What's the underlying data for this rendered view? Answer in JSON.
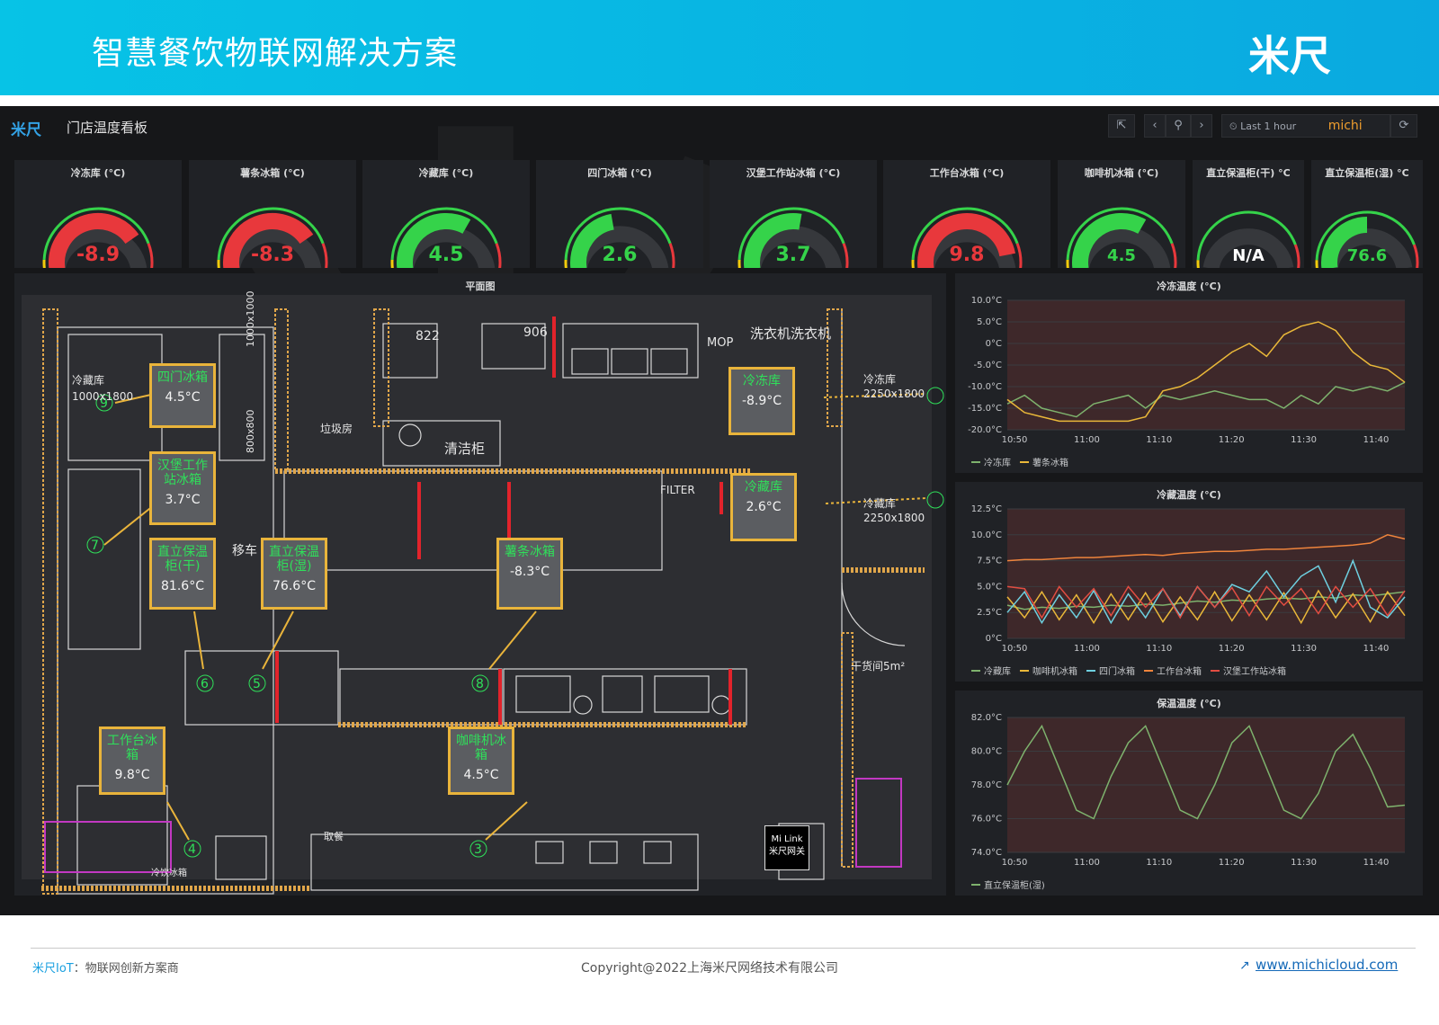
{
  "banner": {
    "title": "智慧餐饮物联网解决方案",
    "logo": "米尺"
  },
  "dashboard": {
    "logo": "米尺",
    "title": "门店温度看板",
    "toolbar": {
      "time_range": "Last 1 hour",
      "user": "michi"
    },
    "gauges": [
      {
        "title": "冷冻库 (°C)",
        "value": "-8.9",
        "level": 0.78,
        "color": "#e8383c"
      },
      {
        "title": "薯条冰箱 (°C)",
        "value": "-8.3",
        "level": 0.78,
        "color": "#e8383c"
      },
      {
        "title": "冷藏库 (°C)",
        "value": "4.5",
        "level": 0.65,
        "color": "#35d34a"
      },
      {
        "title": "四门冰箱 (°C)",
        "value": "2.6",
        "level": 0.45,
        "color": "#35d34a"
      },
      {
        "title": "汉堡工作站冰箱 (°C)",
        "value": "3.7",
        "level": 0.55,
        "color": "#35d34a"
      },
      {
        "title": "工作台冰箱 (°C)",
        "value": "9.8",
        "level": 0.9,
        "color": "#e8383c"
      },
      {
        "title": "咖啡机冰箱 (°C)",
        "value": "4.5",
        "level": 0.65,
        "color": "#35d34a"
      },
      {
        "title": "直立保温柜(干) °C",
        "value": "N/A",
        "level": 0,
        "color": "#ffffff"
      },
      {
        "title": "直立保温柜(湿) °C",
        "value": "76.6",
        "level": 0.5,
        "color": "#35d34a"
      }
    ],
    "floorplan": {
      "title": "平面图",
      "labels": [
        {
          "name": "四门冰箱",
          "temp": "4.5°C"
        },
        {
          "name": "汉堡工作站冰箱",
          "temp": "3.7°C"
        },
        {
          "name": "直立保温柜(干)",
          "temp": "81.6°C"
        },
        {
          "name": "直立保温柜(湿)",
          "temp": "76.6°C"
        },
        {
          "name": "薯条冰箱",
          "temp": "-8.3°C"
        },
        {
          "name": "冷冻库",
          "temp": "-8.9°C"
        },
        {
          "name": "冷藏库",
          "temp": "2.6°C"
        },
        {
          "name": "工作台冰箱",
          "temp": "9.8°C"
        },
        {
          "name": "咖啡机冰箱",
          "temp": "4.5°C"
        }
      ],
      "room_texts": {
        "cold_room": "冷藏库",
        "cold_room_size": "1000x1800",
        "freezer_right": "冷冻库",
        "freezer_right_size": "2250x1800",
        "cold_right": "冷藏库",
        "cold_right_size": "2250x1800",
        "garbage": "垃圾房",
        "cleaning": "清洁柜",
        "mop": "MOP",
        "washer": "洗衣机洗衣机",
        "dry_store": "干货间5m²",
        "filter": "FILTER",
        "gateway_line1": "Mi Link",
        "gateway_line2": "米尺网关",
        "take_meal": "取餐",
        "cold_drink": "冷饮冰箱",
        "num_822": "822",
        "num_906": "906",
        "dim1": "1000x1000",
        "dim2": "800x800",
        "cart": "移车"
      }
    },
    "charts": [
      {
        "title": "冷冻温度 (°C)",
        "chart_data": {
          "type": "line",
          "x": [
            "10:50",
            "11:00",
            "11:10",
            "11:20",
            "11:30",
            "11:40"
          ],
          "y_ticks": [
            "10.0°C",
            "5.0°C",
            "0°C",
            "-5.0°C",
            "-10.0°C",
            "-15.0°C",
            "-20.0°C"
          ],
          "ylim": [
            -20,
            10
          ],
          "series": [
            {
              "name": "冷冻库",
              "color": "#7eb26d",
              "values": [
                -14,
                -12,
                -15,
                -16,
                -17,
                -14,
                -13,
                -12,
                -15,
                -12,
                -13,
                -12,
                -11,
                -12,
                -13,
                -13,
                -15,
                -12,
                -14,
                -10,
                -11,
                -10,
                -11,
                -9
              ]
            },
            {
              "name": "薯条冰箱",
              "color": "#eab839",
              "values": [
                -13,
                -16,
                -17,
                -18,
                -18,
                -18,
                -18,
                -18,
                -17,
                -11,
                -10,
                -8,
                -5,
                -2,
                0,
                -3,
                2,
                4,
                5,
                3,
                -2,
                -5,
                -6,
                -9
              ]
            }
          ]
        }
      },
      {
        "title": "冷藏温度 (°C)",
        "chart_data": {
          "type": "line",
          "x": [
            "10:50",
            "11:00",
            "11:10",
            "11:20",
            "11:30",
            "11:40"
          ],
          "y_ticks": [
            "12.5°C",
            "10.0°C",
            "7.5°C",
            "5.0°C",
            "2.5°C",
            "0°C"
          ],
          "ylim": [
            0,
            12.5
          ],
          "series": [
            {
              "name": "冷藏库",
              "color": "#7eb26d",
              "values": [
                3.2,
                2.8,
                3.0,
                2.9,
                3.1,
                3.0,
                3.2,
                3.1,
                3.3,
                3.2,
                3.4,
                3.6,
                3.5,
                3.7,
                3.6,
                3.8,
                3.9,
                3.8,
                4.0,
                3.9,
                4.2,
                4.1,
                4.3,
                4.5
              ]
            },
            {
              "name": "咖啡机冰箱",
              "color": "#eab839",
              "values": [
                4.0,
                2.0,
                4.5,
                1.8,
                4.2,
                1.5,
                4.3,
                1.8,
                4.4,
                1.6,
                4.0,
                1.8,
                4.5,
                1.7,
                4.2,
                1.8,
                4.4,
                1.5,
                4.6,
                2.0,
                4.3,
                1.6,
                4.5,
                2.2
              ]
            },
            {
              "name": "四门冰箱",
              "color": "#6ed0e0",
              "values": [
                2.5,
                4.5,
                1.5,
                4.2,
                2.0,
                4.6,
                1.5,
                4.3,
                2.0,
                4.8,
                2.2,
                5.0,
                3.0,
                5.2,
                4.5,
                6.5,
                4.0,
                6.0,
                7.0,
                3.5,
                7.5,
                3.0,
                2.0,
                4.0
              ]
            },
            {
              "name": "工作台冰箱",
              "color": "#ef843c",
              "values": [
                7.5,
                7.6,
                7.6,
                7.7,
                7.8,
                7.8,
                7.9,
                8.0,
                8.1,
                8.0,
                8.2,
                8.3,
                8.4,
                8.4,
                8.5,
                8.6,
                8.6,
                8.7,
                8.8,
                8.9,
                9.0,
                9.2,
                10.0,
                9.6
              ]
            },
            {
              "name": "汉堡工作站冰箱",
              "color": "#e24d42",
              "values": [
                5.0,
                4.8,
                2.0,
                5.0,
                3.0,
                4.8,
                2.2,
                5.0,
                3.0,
                4.8,
                2.0,
                5.0,
                3.0,
                4.9,
                2.2,
                5.0,
                3.2,
                4.8,
                2.4,
                5.0,
                3.0,
                4.8,
                2.2,
                4.6
              ]
            }
          ]
        }
      },
      {
        "title": "保温温度 (°C)",
        "chart_data": {
          "type": "line",
          "x": [
            "10:50",
            "11:00",
            "11:10",
            "11:20",
            "11:30",
            "11:40"
          ],
          "y_ticks": [
            "82.0°C",
            "80.0°C",
            "78.0°C",
            "76.0°C",
            "74.0°C"
          ],
          "ylim": [
            74,
            82
          ],
          "series": [
            {
              "name": "直立保温柜(湿)",
              "color": "#7eb26d",
              "values": [
                78.0,
                80.0,
                81.5,
                79.0,
                76.5,
                76.0,
                78.5,
                80.5,
                81.5,
                79.0,
                76.5,
                76.0,
                78.0,
                80.5,
                81.5,
                79.0,
                76.5,
                76.0,
                77.5,
                80.0,
                81.0,
                79.0,
                76.7,
                76.8
              ]
            }
          ]
        }
      }
    ]
  },
  "footer": {
    "brand": "米尺IoT",
    "slogan": "：物联网创新方案商",
    "copyright": "Copyright@2022上海米尺网络技术有限公司",
    "url": "www.michicloud.com"
  }
}
